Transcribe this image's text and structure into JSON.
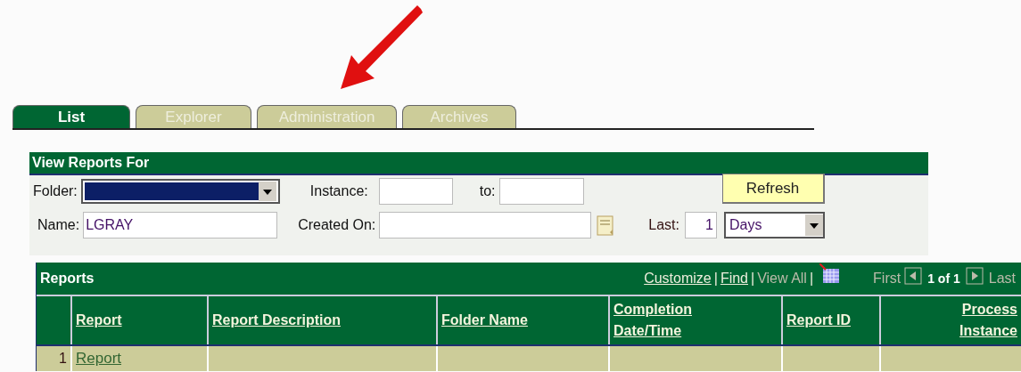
{
  "tabs": [
    {
      "label": "List",
      "selected": true
    },
    {
      "label": "Explorer",
      "selected": false
    },
    {
      "label": "Administration",
      "selected": false
    },
    {
      "label": "Archives",
      "selected": false
    }
  ],
  "view_reports_for": {
    "title": "View Reports For",
    "folder_label": "Folder:",
    "instance_label": "Instance:",
    "to_label": "to:",
    "refresh_button": "Refresh",
    "name_label": "Name:",
    "name_value": "LGRAY",
    "created_on_label": "Created On:",
    "last_label": "Last:",
    "last_value": "1",
    "period_value": "Days"
  },
  "reports": {
    "title": "Reports",
    "links": [
      "Customize",
      "Find"
    ],
    "view_all": "View All",
    "separator": "|",
    "first": "First",
    "page": "1 of 1",
    "last": "Last",
    "columns": [
      "Report",
      "Report Description",
      "Folder Name",
      "Completion Date/Time",
      "Report ID",
      "Process Instance"
    ],
    "rows": [
      {
        "number": "1",
        "report": "Report"
      }
    ]
  }
}
